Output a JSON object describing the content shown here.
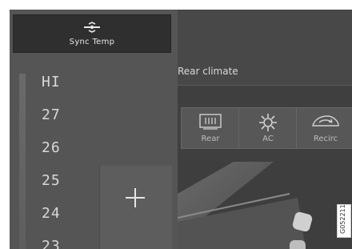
{
  "sync": {
    "label": "Sync Temp",
    "icon": "sync-temp-icon"
  },
  "temperatures": [
    "HI",
    "27",
    "26",
    "25",
    "24",
    "23"
  ],
  "plus": {
    "icon": "plus-icon"
  },
  "rear": {
    "title": "Rear climate",
    "controls": [
      {
        "label": "Rear",
        "icon": "rear-defrost-icon"
      },
      {
        "label": "AC",
        "icon": "ac-snowflake-icon"
      },
      {
        "label": "Recirc",
        "icon": "recirculation-icon"
      }
    ]
  },
  "watermark": "G052211",
  "colors": {
    "panel": "#555555",
    "sync_bg": "#2f2f2f",
    "text": "#d9d9d9",
    "seat_highlight": "#d0d0d0"
  }
}
